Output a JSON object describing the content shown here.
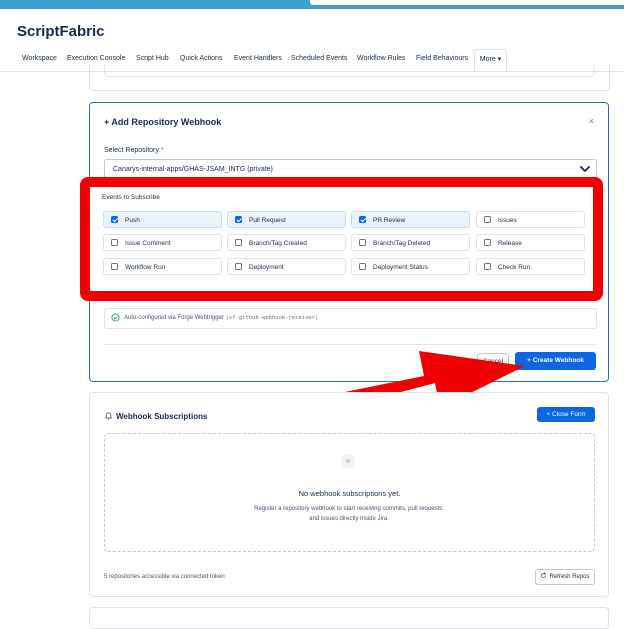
{
  "app": {
    "title": "ScriptFabric"
  },
  "nav": {
    "tabs": [
      {
        "label": "Workspace"
      },
      {
        "label": "Execution Console"
      },
      {
        "label": "Script Hub"
      },
      {
        "label": "Quick Actions"
      },
      {
        "label": "Event Handlers"
      },
      {
        "label": "Scheduled Events"
      },
      {
        "label": "Workflow Rules"
      },
      {
        "label": "Field Behaviours"
      }
    ],
    "more_label": "More ▾"
  },
  "webhook_form": {
    "title": "+ Add Repository Webhook",
    "close_label": "×",
    "repo_label": "Select Repository",
    "required_mark": "*",
    "repo_value": "Canarys-internal-apps/GHAS-JSAM_INTG (private)",
    "events_label": "Events to Subscribe",
    "events": [
      {
        "label": "Push",
        "checked": true
      },
      {
        "label": "Pull Request",
        "checked": true
      },
      {
        "label": "PR Review",
        "checked": true
      },
      {
        "label": "Issues",
        "checked": false
      },
      {
        "label": "Issue Comment",
        "checked": false
      },
      {
        "label": "Branch/Tag Created",
        "checked": false
      },
      {
        "label": "Branch/Tag Deleted",
        "checked": false
      },
      {
        "label": "Release",
        "checked": false
      },
      {
        "label": "Workflow Run",
        "checked": false
      },
      {
        "label": "Deployment",
        "checked": false
      },
      {
        "label": "Deployment Status",
        "checked": false
      },
      {
        "label": "Check Run",
        "checked": false
      }
    ],
    "auto_text": "Auto-configured via Forge Webtrigger",
    "auto_code": "(sf-github-webhook-receiver)",
    "cancel_label": "Cancel",
    "create_label": "+ Create Webhook"
  },
  "subscriptions": {
    "title": "Webhook Subscriptions",
    "close_form_label": "× Close Form",
    "empty_title": "No webhook subscriptions yet.",
    "empty_desc": "Register a repository webhook to start receiving commits, pull requests, and issues directly inside Jira.",
    "access_text": "5 repositories accessible via connected token",
    "refresh_label": "Refresh Repos"
  },
  "colors": {
    "accent": "#0c66e4",
    "annotation": "#f20000",
    "topbar": "#3f9fd0"
  }
}
